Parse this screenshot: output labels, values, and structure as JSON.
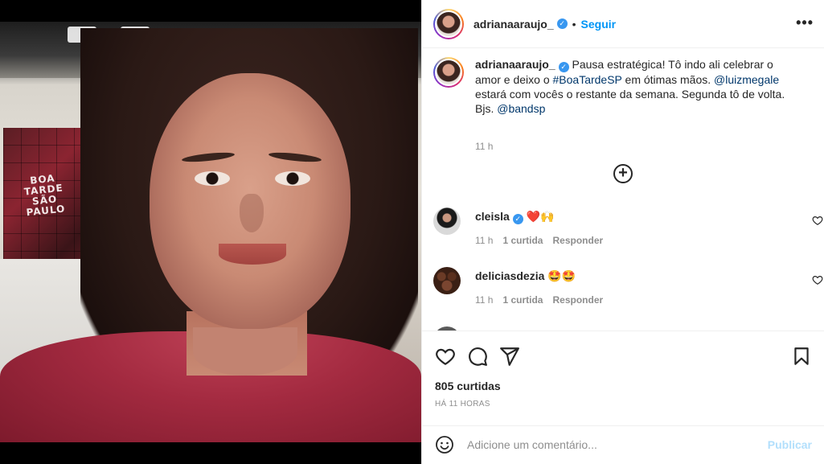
{
  "post": {
    "username": "adrianaaraujo_",
    "follow_label": "Seguir",
    "separator": "•",
    "more_label": "•••"
  },
  "photo": {
    "screen_text": [
      "BOA",
      "TARDE",
      "SÃO",
      "PAULO"
    ]
  },
  "caption": {
    "username": "adrianaaraujo_",
    "text_1": " Pausa estratégica! Tô indo ali celebrar o amor e deixo o ",
    "hashtag": "#BoaTardeSP",
    "text_2": " em ótimas mãos. ",
    "mention_1": "@luizmegale",
    "text_3": " estará com vocês o restante da semana. Segunda tô de volta. Bjs. ",
    "mention_2": "@bandsp",
    "time": "11 h"
  },
  "load_more_label": "+",
  "comments": [
    {
      "username": "cleisla",
      "text": "❤️🙌",
      "time": "11 h",
      "likes": "1 curtida",
      "reply": "Responder"
    },
    {
      "username": "deliciasdezia",
      "text": "🤩🤩",
      "time": "11 h",
      "likes": "1 curtida",
      "reply": "Responder"
    }
  ],
  "likes_count": "805 curtidas",
  "posted_ago": "HÁ 11 HORAS",
  "comment_box": {
    "placeholder": "Adicione um comentário...",
    "publish_label": "Publicar"
  },
  "colors": {
    "link": "#00376b",
    "follow": "#0095f6",
    "verified": "#3897f0",
    "muted": "#8e8e8e",
    "publish_disabled": "#b2dffc"
  }
}
